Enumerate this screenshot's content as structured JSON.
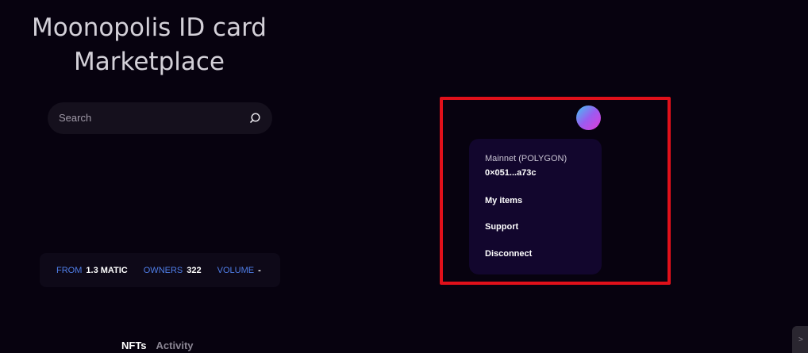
{
  "page": {
    "title": "Moonopolis ID card Marketplace"
  },
  "search": {
    "placeholder": "Search",
    "icon": "search-icon"
  },
  "stats": {
    "from_label": "FROM",
    "from_value": "1.3 MATIC",
    "owners_label": "OWNERS",
    "owners_value": "322",
    "volume_label": "VOLUME",
    "volume_value": "-"
  },
  "tabs": [
    {
      "label": "NFTs",
      "active": true
    },
    {
      "label": "Activity",
      "active": false
    }
  ],
  "account_menu": {
    "network": "Mainnet (POLYGON)",
    "address": "0×051...a73c",
    "items": [
      {
        "label": "My items"
      },
      {
        "label": "Support"
      },
      {
        "label": "Disconnect"
      }
    ]
  },
  "corner_button": {
    "glyph": ">"
  },
  "colors": {
    "background": "#07020f",
    "accent_blue": "#4f7ee8",
    "menu_bg": "#12062d",
    "highlight_red": "#e0101a"
  }
}
